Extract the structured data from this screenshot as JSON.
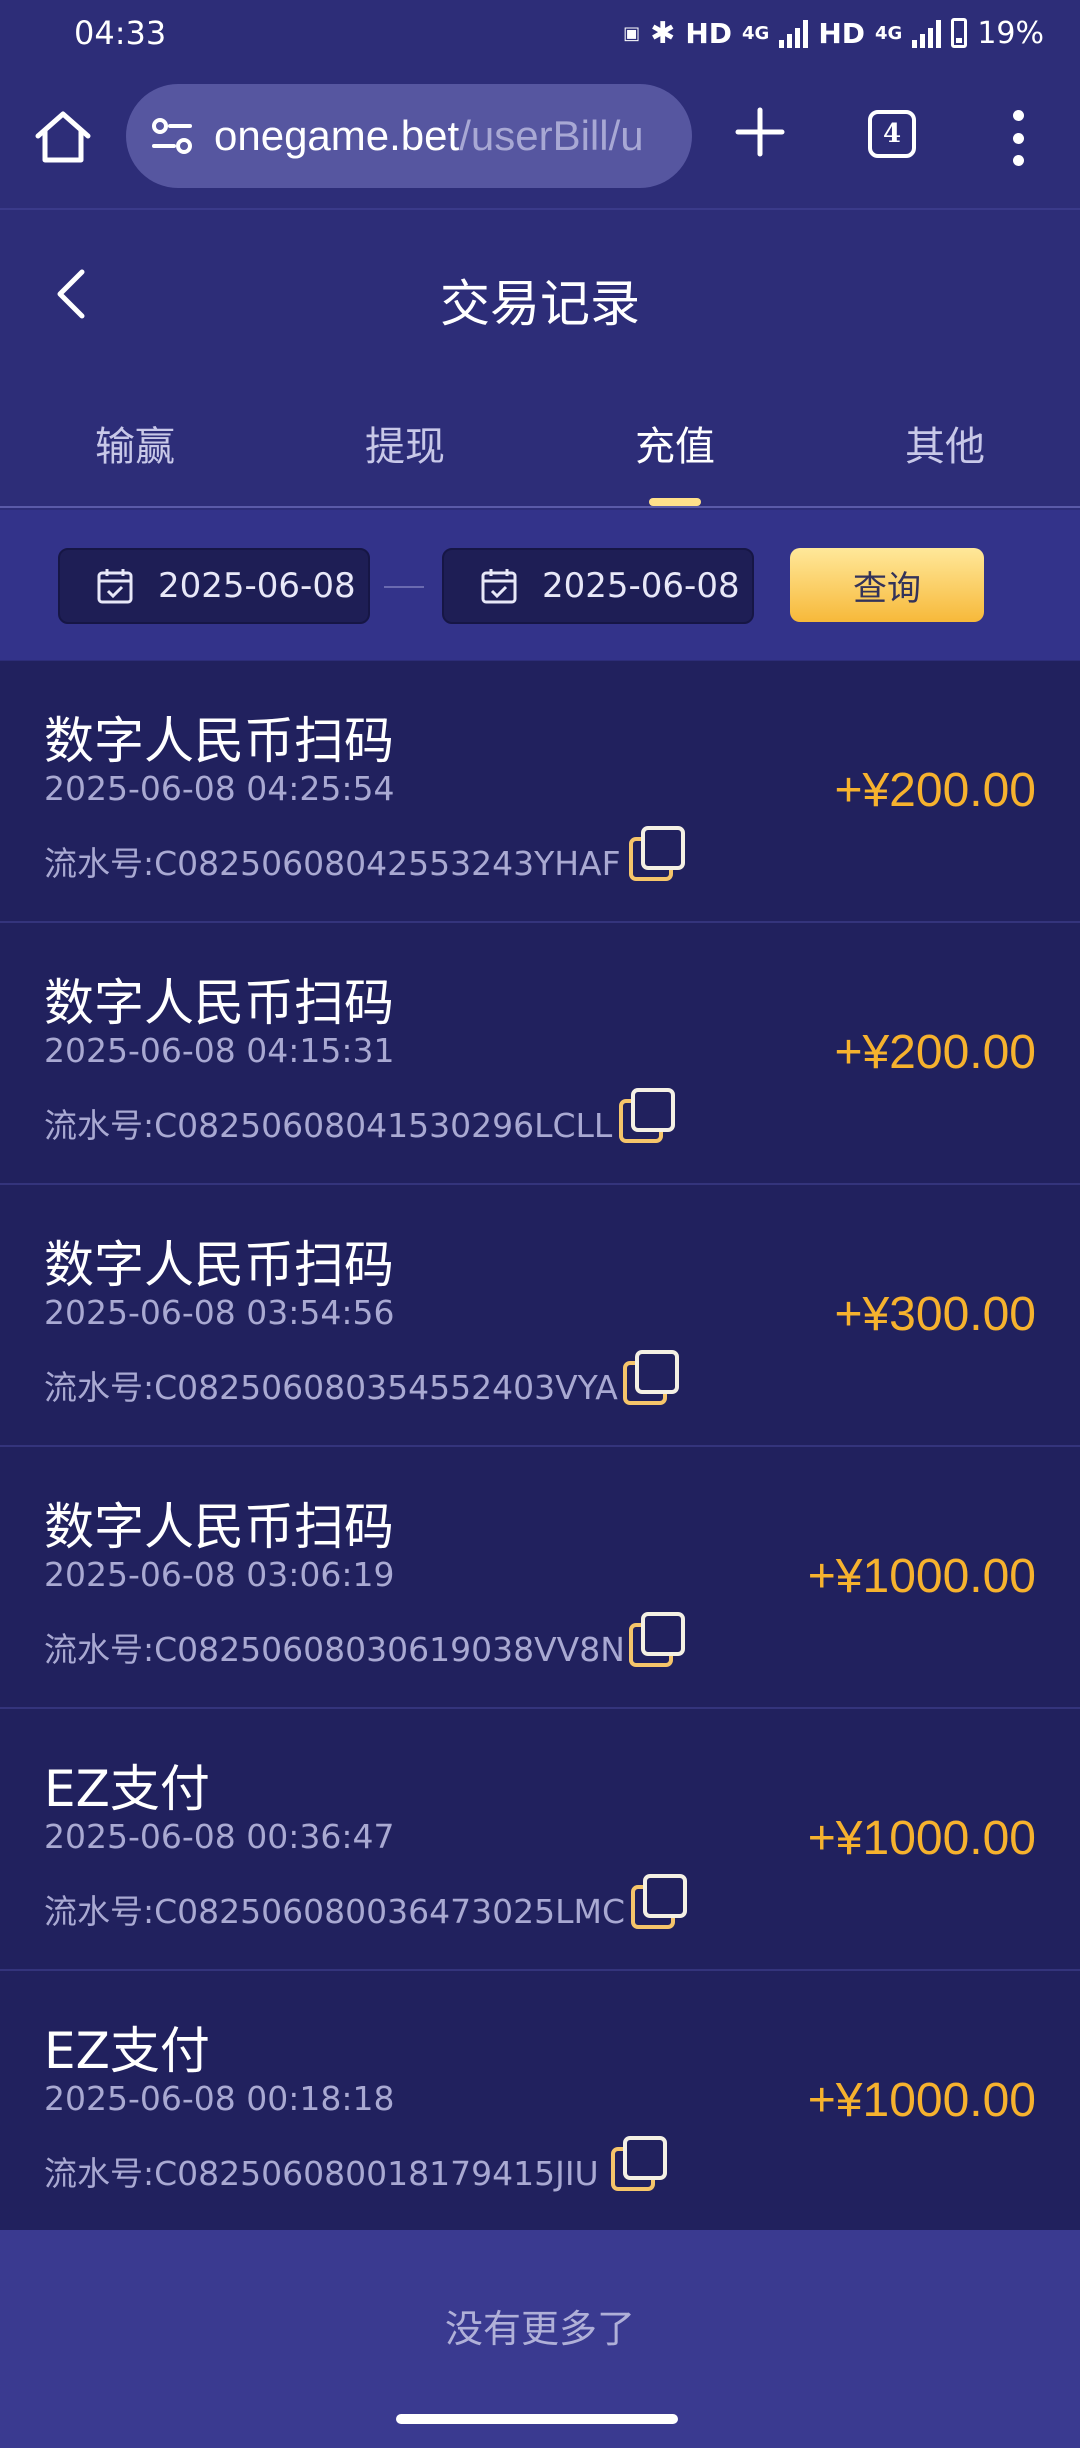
{
  "status_bar": {
    "time": "04:33",
    "hd1": "HD",
    "net1": "4G",
    "hd2": "HD",
    "net2": "4G",
    "battery": "19%",
    "sim1": "1",
    "sim2": "2"
  },
  "browser": {
    "url_domain": "onegame.bet",
    "url_path": "/userBill/u",
    "tab_count": "4"
  },
  "header": {
    "title": "交易记录"
  },
  "tabs": [
    {
      "label": "输赢"
    },
    {
      "label": "提现"
    },
    {
      "label": "充值",
      "active": true
    },
    {
      "label": "其他"
    }
  ],
  "filter": {
    "start_date": "2025-06-08",
    "end_date": "2025-06-08",
    "query_label": "查询"
  },
  "records": [
    {
      "title": "数字人民币扫码",
      "time": "2025-06-08 04:25:54",
      "serial": "流水号:C08250608042553243YHAF",
      "amount": "+¥200.00"
    },
    {
      "title": "数字人民币扫码",
      "time": "2025-06-08 04:15:31",
      "serial": "流水号:C08250608041530296LCLL",
      "amount": "+¥200.00"
    },
    {
      "title": "数字人民币扫码",
      "time": "2025-06-08 03:54:56",
      "serial": "流水号:C0825060803545524 03VYA",
      "amount": "+¥300.00"
    },
    {
      "title": "数字人民币扫码",
      "time": "2025-06-08 03:06:19",
      "serial": "流水号:C08250608030619038VV8N",
      "amount": "+¥1000.00"
    },
    {
      "title": "EZ支付",
      "time": "2025-06-08 00:36:47",
      "serial": "流水号:C08250608003647302 5LMC",
      "amount": "+¥1000.00"
    },
    {
      "title": "EZ支付",
      "time": "2025-06-08 00:18:18",
      "serial": "流水号:C08250608001817941 5JIU",
      "amount": "+¥1000.00"
    }
  ],
  "footer": {
    "no_more": "没有更多了"
  },
  "colors": {
    "background": "#2d2d78",
    "list_bg": "#21215e",
    "amount": "#f6b22e",
    "accent": "#ffe08a"
  }
}
